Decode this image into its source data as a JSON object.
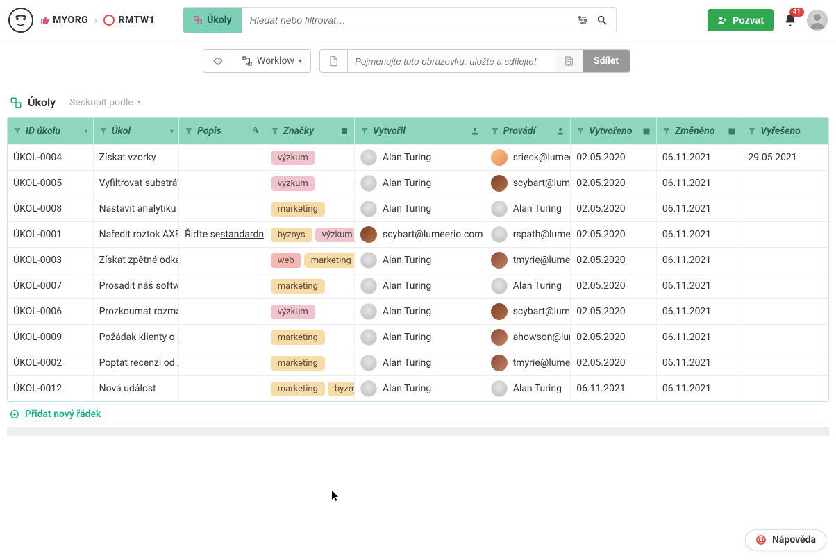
{
  "breadcrumb": {
    "org": "MYORG",
    "project": "RMTW1"
  },
  "search": {
    "pill": "Úkoly",
    "placeholder": "Hledat nebo filtrovat…"
  },
  "top": {
    "invite": "Pozvat",
    "notif_count": "41"
  },
  "toolbar": {
    "workflow": "Worklow",
    "view_placeholder": "Pojmenujte tuto obrazovku, uložte a sdílejte!",
    "share": "Sdílet"
  },
  "subheader": {
    "title": "Úkoly",
    "group": "Seskupit podle"
  },
  "columns": [
    "ID úkolu",
    "Úkol",
    "Popis",
    "Značky",
    "Vytvořil",
    "Provádí",
    "Vytvořeno",
    "Změněno",
    "Vyřešeno"
  ],
  "rows": [
    {
      "id": "ÚKOL-0004",
      "ukol": "Získat vzorky",
      "popis": "",
      "tags": [
        {
          "t": "výzkum",
          "c": "vyzkum"
        }
      ],
      "vytvoril": {
        "name": "Alan Turing",
        "av": "grey"
      },
      "provadi": {
        "name": "srieck@lumeerio.com",
        "av": "or"
      },
      "vytvoreno": "02.05.2020",
      "zmeneno": "06.11.2021",
      "vyreseno": "29.05.2021"
    },
    {
      "id": "ÚKOL-0005",
      "ukol": "Vyfiltrovat substrát",
      "popis": "",
      "tags": [
        {
          "t": "výzkum",
          "c": "vyzkum"
        }
      ],
      "vytvoril": {
        "name": "Alan Turing",
        "av": "grey"
      },
      "provadi": {
        "name": "scybart@lumeerio.com",
        "av": "br"
      },
      "vytvoreno": "02.05.2020",
      "zmeneno": "06.11.2021",
      "vyreseno": ""
    },
    {
      "id": "ÚKOL-0008",
      "ukol": "Nastavit analytiku a",
      "popis": "",
      "tags": [
        {
          "t": "marketing",
          "c": "marketing"
        }
      ],
      "vytvoril": {
        "name": "Alan Turing",
        "av": "grey"
      },
      "provadi": {
        "name": "Alan Turing",
        "av": "grey"
      },
      "vytvoreno": "02.05.2020",
      "zmeneno": "06.11.2021",
      "vyreseno": ""
    },
    {
      "id": "ÚKOL-0001",
      "ukol": "Naředit roztok AXE",
      "popis": "Řiďte se ",
      "popis_link": "standardn",
      "tags": [
        {
          "t": "byznys",
          "c": "byznys"
        },
        {
          "t": "výzkum",
          "c": "vyzkum"
        }
      ],
      "vytvoril": {
        "name": "scybart@lumeerio.com",
        "av": "br"
      },
      "provadi": {
        "name": "rspath@lumeerio.com",
        "av": "grey"
      },
      "vytvoreno": "02.05.2020",
      "zmeneno": "06.11.2021",
      "vyreseno": ""
    },
    {
      "id": "ÚKOL-0003",
      "ukol": "Získat zpětné odkaz",
      "popis": "",
      "tags": [
        {
          "t": "web",
          "c": "web"
        },
        {
          "t": "marketing",
          "c": "marketing"
        }
      ],
      "vytvoril": {
        "name": "Alan Turing",
        "av": "grey"
      },
      "provadi": {
        "name": "tmyrie@lumeerio.com",
        "av": "br2"
      },
      "vytvoreno": "02.05.2020",
      "zmeneno": "06.11.2021",
      "vyreseno": ""
    },
    {
      "id": "ÚKOL-0007",
      "ukol": "Prosadit náš softwa",
      "popis": "",
      "tags": [
        {
          "t": "marketing",
          "c": "marketing"
        }
      ],
      "vytvoril": {
        "name": "Alan Turing",
        "av": "grey"
      },
      "provadi": {
        "name": "Alan Turing",
        "av": "grey"
      },
      "vytvoreno": "02.05.2020",
      "zmeneno": "06.11.2021",
      "vyreseno": ""
    },
    {
      "id": "ÚKOL-0006",
      "ukol": "Prozkoumat rozmac",
      "popis": "",
      "tags": [
        {
          "t": "výzkum",
          "c": "vyzkum"
        }
      ],
      "vytvoril": {
        "name": "Alan Turing",
        "av": "grey"
      },
      "provadi": {
        "name": "scybart@lumeerio.com",
        "av": "br"
      },
      "vytvoreno": "02.05.2020",
      "zmeneno": "06.11.2021",
      "vyreseno": ""
    },
    {
      "id": "ÚKOL-0009",
      "ukol": "Požádak klienty o h",
      "popis": "",
      "tags": [
        {
          "t": "marketing",
          "c": "marketing"
        }
      ],
      "vytvoril": {
        "name": "Alan Turing",
        "av": "grey"
      },
      "provadi": {
        "name": "ahowson@lumeerio.com",
        "av": "br2"
      },
      "vytvoreno": "02.05.2020",
      "zmeneno": "06.11.2021",
      "vyreseno": ""
    },
    {
      "id": "ÚKOL-0002",
      "ukol": "Poptat recenzi od A",
      "popis": "",
      "tags": [
        {
          "t": "marketing",
          "c": "marketing"
        }
      ],
      "vytvoril": {
        "name": "Alan Turing",
        "av": "grey"
      },
      "provadi": {
        "name": "tmyrie@lumeerio.com",
        "av": "br2"
      },
      "vytvoreno": "02.05.2020",
      "zmeneno": "06.11.2021",
      "vyreseno": ""
    },
    {
      "id": "ÚKOL-0012",
      "ukol": "Nová událost",
      "popis": "",
      "tags": [
        {
          "t": "marketing",
          "c": "marketing"
        },
        {
          "t": "byznys",
          "c": "byznys"
        }
      ],
      "vytvoril": {
        "name": "Alan Turing",
        "av": "grey"
      },
      "provadi": {
        "name": "Alan Turing",
        "av": "grey"
      },
      "vytvoreno": "06.11.2021",
      "zmeneno": "06.11.2021",
      "vyreseno": ""
    }
  ],
  "add_row": "Přidat nový řádek",
  "help": "Nápověda"
}
